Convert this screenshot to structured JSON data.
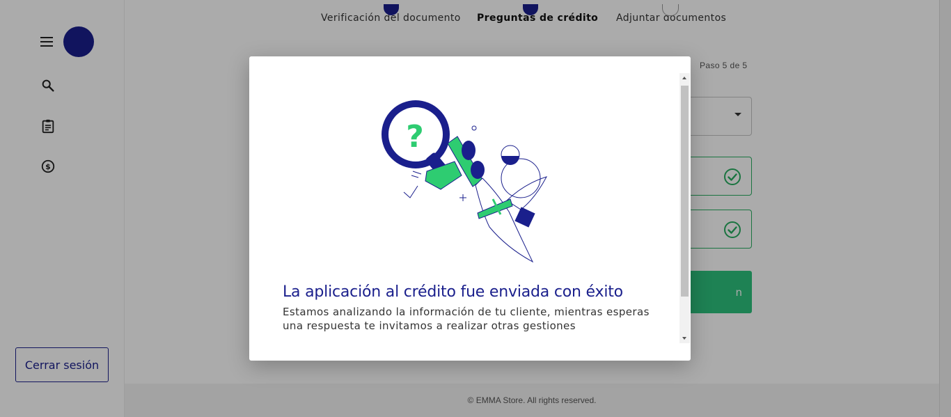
{
  "colors": {
    "brand": "#1a1f8c",
    "accent": "#2ec27e",
    "success": "#27ae60"
  },
  "sidebar": {
    "menu_icon": "hamburger-icon",
    "items": [
      {
        "icon": "search-icon"
      },
      {
        "icon": "clipboard-icon"
      },
      {
        "icon": "dollar-circle-icon"
      }
    ],
    "logout_label": "Cerrar sesión"
  },
  "stepper": {
    "steps": [
      {
        "label": "Verificación del documento",
        "state": "completed"
      },
      {
        "label": "Preguntas de crédito",
        "state": "active"
      },
      {
        "label": "Adjuntar documentos",
        "state": "pending"
      }
    ],
    "counter": "Paso 5 de 5"
  },
  "form": {
    "submit_label_visible": "n"
  },
  "footer": {
    "text": "© EMMA Store. All rights reserved."
  },
  "modal": {
    "illustration": "magnifier-question-illustration",
    "title": "La aplicación al crédito fue enviada con éxito",
    "message": "Estamos analizando la información de tu cliente, mientras esperas una respuesta te invitamos a realizar otras gestiones"
  }
}
